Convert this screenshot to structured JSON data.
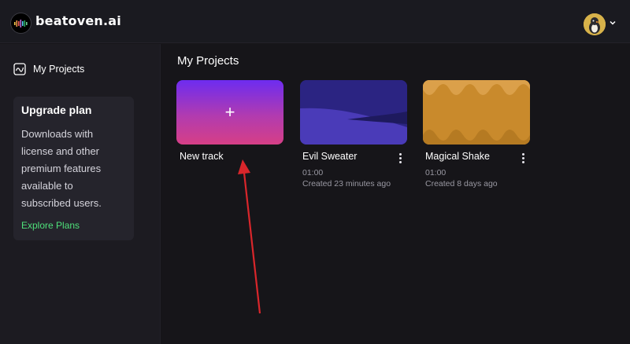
{
  "app": {
    "brand": "beatoven.ai"
  },
  "header": {
    "logo_icon": "equalizer-logo-icon",
    "avatar_icon": "user-avatar-icon",
    "menu_icon": "chevron-down-icon"
  },
  "sidebar": {
    "nav_item": {
      "label": "My Projects",
      "icon": "projects-icon"
    },
    "upgrade": {
      "title": "Upgrade plan",
      "description_lines": [
        "Downloads with",
        "license and other",
        "premium features",
        "available to",
        "subscribed users."
      ],
      "link_label": "Explore Plans",
      "link_color": "#4ee07a"
    }
  },
  "main": {
    "title": "My Projects",
    "new_track": {
      "label": "New track",
      "icon": "plus-icon"
    },
    "projects": [
      {
        "name": "Evil Sweater",
        "duration": "01:00",
        "created": "Created 23 minutes ago",
        "menu_icon": "more-vertical-icon"
      },
      {
        "name": "Magical Shake",
        "duration": "01:00",
        "created": "Created 8 days ago",
        "menu_icon": "more-vertical-icon"
      }
    ]
  },
  "annotation": {
    "arrow_color": "#d9262b"
  }
}
